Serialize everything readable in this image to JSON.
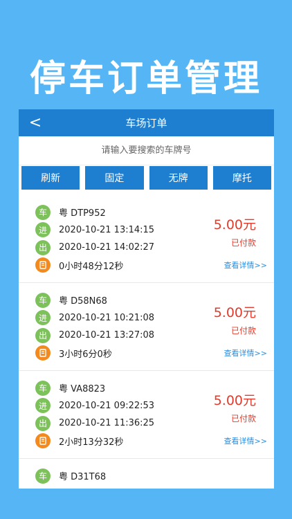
{
  "promo": {
    "title": "停车订单管理"
  },
  "navbar": {
    "back_glyph": "<",
    "title": "车场订单"
  },
  "search": {
    "placeholder": "请输入要搜索的车牌号"
  },
  "filters": [
    "刷新",
    "固定",
    "无牌",
    "摩托"
  ],
  "labels": {
    "car": "车",
    "in": "进",
    "out": "出",
    "icon_name": "time-icon"
  },
  "orders": [
    {
      "plate": "粤 DTP952",
      "in_time": "2020-10-21 13:14:15",
      "out_time": "2020-10-21 14:02:27",
      "duration": "0小时48分12秒",
      "amount": "5.00元",
      "status": "已付款",
      "detail": "查看详情>>"
    },
    {
      "plate": "粤 D58N68",
      "in_time": "2020-10-21 10:21:08",
      "out_time": "2020-10-21 13:27:08",
      "duration": "3小时6分0秒",
      "amount": "5.00元",
      "status": "已付款",
      "detail": "查看详情>>"
    },
    {
      "plate": "粤 VA8823",
      "in_time": "2020-10-21 09:22:53",
      "out_time": "2020-10-21 11:36:25",
      "duration": "2小时13分32秒",
      "amount": "5.00元",
      "status": "已付款",
      "detail": "查看详情>>"
    },
    {
      "plate": "粤 D31T68"
    }
  ],
  "colors": {
    "background": "#56b6f5",
    "navbar": "#1e7fd1",
    "badge_green": "#7cc15a",
    "badge_orange": "#f28a1f",
    "amount_red": "#e23b2c",
    "link_blue": "#2a8ee0"
  }
}
